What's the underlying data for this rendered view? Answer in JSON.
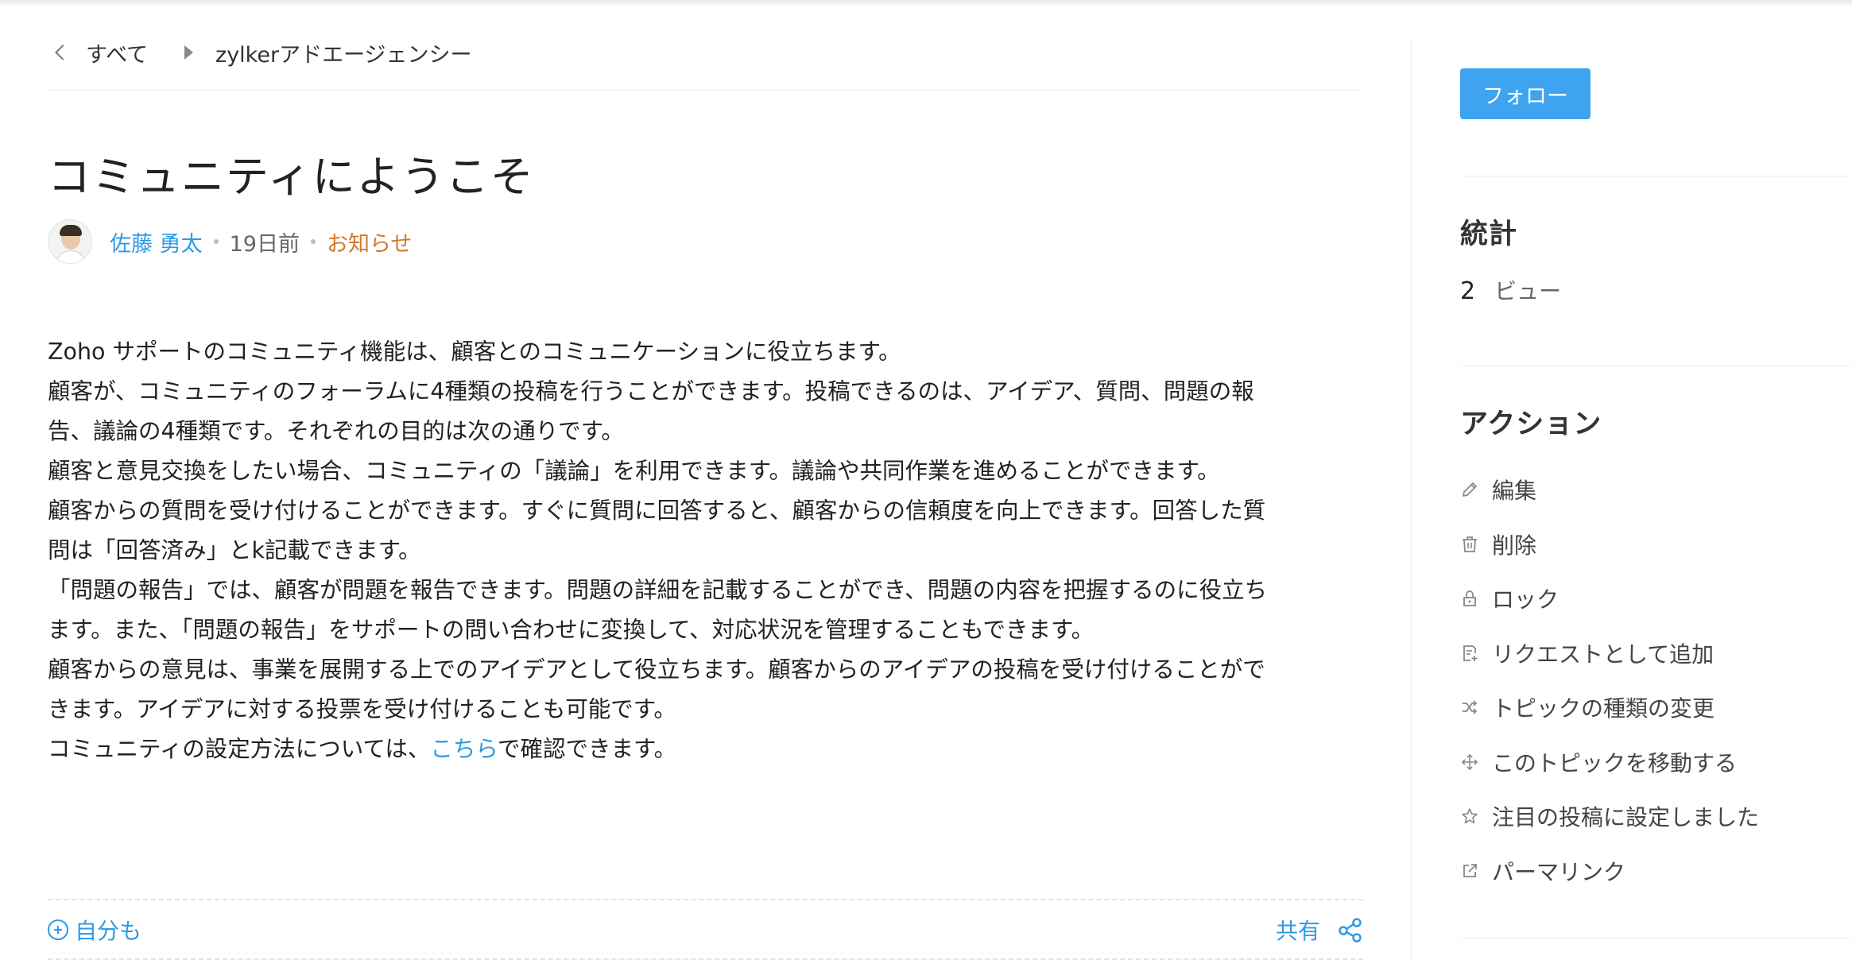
{
  "breadcrumb": {
    "all": "すべて",
    "category": "zylkerアドエージェンシー"
  },
  "topic": {
    "title": "コミュニティにようこそ",
    "author": "佐藤 勇太",
    "time": "19日前",
    "type": "お知らせ",
    "body_lines": [
      "Zoho サポートのコミュニティ機能は、顧客とのコミュニケーションに役立ちます。",
      "顧客が、コミュニティのフォーラムに4種類の投稿を行うことができます。投稿できるのは、アイデア、質問、問題の報",
      "告、議論の4種類です。それぞれの目的は次の通りです。",
      "顧客と意見交換をしたい場合、コミュニティの「議論」を利用できます。議論や共同作業を進めることができます。",
      "顧客からの質問を受け付けることができます。すぐに質問に回答すると、顧客からの信頼度を向上できます。回答した質",
      "問は「回答済み」とk記載できます。",
      "「問題の報告」では、顧客が問題を報告できます。問題の詳細を記載することができ、問題の内容を把握するのに役立ち",
      "ます。また、「問題の報告」をサポートの問い合わせに変換して、対応状況を管理することもできます。",
      "顧客からの意見は、事業を展開する上でのアイデアとして役立ちます。顧客からのアイデアの投稿を受け付けることがで",
      "きます。アイデアに対する投票を受け付けることも可能です。"
    ],
    "last_line_before": "コミュニティの設定方法については、",
    "last_line_link": "こちら",
    "last_line_after": "で確認できます。"
  },
  "footer": {
    "metoo": "自分も",
    "share": "共有"
  },
  "sidebar": {
    "follow": "フォロー",
    "stats_heading": "統計",
    "views_count": "2",
    "views_label": "ビュー",
    "actions_heading": "アクション",
    "actions": [
      {
        "label": "編集",
        "icon": "pencil-icon"
      },
      {
        "label": "削除",
        "icon": "trash-icon"
      },
      {
        "label": "ロック",
        "icon": "lock-icon"
      },
      {
        "label": "リクエストとして追加",
        "icon": "add-request-icon"
      },
      {
        "label": "トピックの種類の変更",
        "icon": "shuffle-icon"
      },
      {
        "label": "このトピックを移動する",
        "icon": "move-icon"
      },
      {
        "label": "注目の投稿に設定しました",
        "icon": "star-icon"
      },
      {
        "label": "パーマリンク",
        "icon": "external-link-icon"
      }
    ]
  },
  "colors": {
    "link": "#2d9be6",
    "tag": "#d2782a",
    "button": "#3fa4f0"
  }
}
